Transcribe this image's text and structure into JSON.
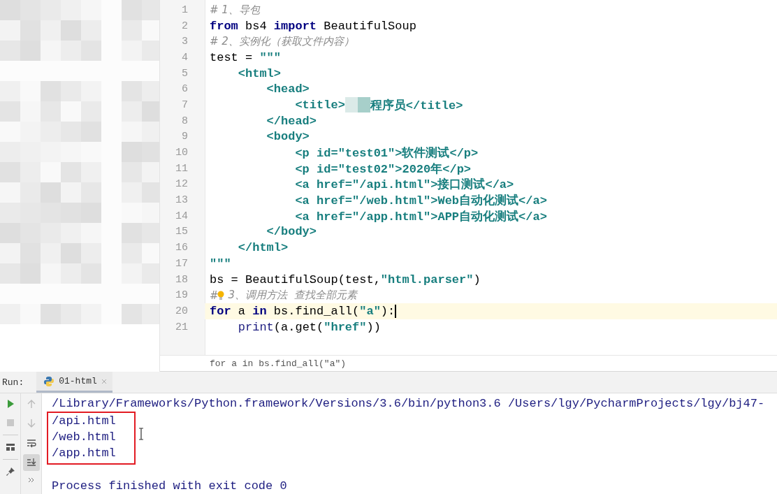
{
  "editor": {
    "lines": [
      {
        "number": "1",
        "current": false,
        "tokens": [
          {
            "kind": "comment",
            "text": "# 1、导包"
          }
        ]
      },
      {
        "number": "2",
        "current": false,
        "tokens": [
          {
            "kind": "keyword",
            "text": "from"
          },
          {
            "kind": "plain",
            "text": " bs4 "
          },
          {
            "kind": "keyword",
            "text": "import"
          },
          {
            "kind": "plain",
            "text": " BeautifulSoup"
          }
        ]
      },
      {
        "number": "3",
        "current": false,
        "tokens": [
          {
            "kind": "comment",
            "text": "# 2、实例化（获取文件内容）"
          }
        ]
      },
      {
        "number": "4",
        "current": false,
        "tokens": [
          {
            "kind": "plain",
            "text": "test = "
          },
          {
            "kind": "string",
            "text": "\"\"\""
          }
        ]
      },
      {
        "number": "5",
        "current": false,
        "tokens": [
          {
            "kind": "tag",
            "text": "    <html>"
          }
        ]
      },
      {
        "number": "6",
        "current": false,
        "tokens": [
          {
            "kind": "tag",
            "text": "        <head>"
          }
        ]
      },
      {
        "number": "7",
        "current": false,
        "tokens": [
          {
            "kind": "tag",
            "text": "            <title>"
          },
          {
            "kind": "redacted"
          },
          {
            "kind": "tag",
            "text": "程序员</title>"
          }
        ]
      },
      {
        "number": "8",
        "current": false,
        "tokens": [
          {
            "kind": "tag",
            "text": "        </head>"
          }
        ]
      },
      {
        "number": "9",
        "current": false,
        "tokens": [
          {
            "kind": "tag",
            "text": "        <body>"
          }
        ]
      },
      {
        "number": "10",
        "current": false,
        "tokens": [
          {
            "kind": "tag",
            "text": "            <p id=\"test01\">软件测试</p>"
          }
        ]
      },
      {
        "number": "11",
        "current": false,
        "tokens": [
          {
            "kind": "tag",
            "text": "            <p id=\"test02\">2020年</p>"
          }
        ]
      },
      {
        "number": "12",
        "current": false,
        "tokens": [
          {
            "kind": "tag",
            "text": "            <a href=\"/api.html\">接口测试</a>"
          }
        ]
      },
      {
        "number": "13",
        "current": false,
        "tokens": [
          {
            "kind": "tag",
            "text": "            <a href=\"/web.html\">Web自动化测试</a>"
          }
        ]
      },
      {
        "number": "14",
        "current": false,
        "tokens": [
          {
            "kind": "tag",
            "text": "            <a href=\"/app.html\">APP自动化测试</a>"
          }
        ]
      },
      {
        "number": "15",
        "current": false,
        "tokens": [
          {
            "kind": "tag",
            "text": "        </body>"
          }
        ]
      },
      {
        "number": "16",
        "current": false,
        "tokens": [
          {
            "kind": "tag",
            "text": "    </html>"
          }
        ]
      },
      {
        "number": "17",
        "current": false,
        "tokens": [
          {
            "kind": "string",
            "text": "\"\"\""
          }
        ]
      },
      {
        "number": "18",
        "current": false,
        "tokens": [
          {
            "kind": "plain",
            "text": "bs = BeautifulSoup(test,"
          },
          {
            "kind": "string",
            "text": "\"html.parser\""
          },
          {
            "kind": "plain",
            "text": ")"
          }
        ]
      },
      {
        "number": "19",
        "current": false,
        "tokens": [
          {
            "kind": "comment",
            "text": "#"
          },
          {
            "kind": "bulb"
          },
          {
            "kind": "comment",
            "text": "3、调用方法  查找全部元素"
          }
        ]
      },
      {
        "number": "20",
        "current": true,
        "tokens": [
          {
            "kind": "keyword",
            "text": "for"
          },
          {
            "kind": "plain",
            "text": " a "
          },
          {
            "kind": "keyword",
            "text": "in"
          },
          {
            "kind": "plain",
            "text": " bs.find_all("
          },
          {
            "kind": "string",
            "text": "\"a\""
          },
          {
            "kind": "plain",
            "text": "):"
          },
          {
            "kind": "caret"
          }
        ]
      },
      {
        "number": "21",
        "current": false,
        "tokens": [
          {
            "kind": "builtin",
            "text": "    print"
          },
          {
            "kind": "plain",
            "text": "(a.get("
          },
          {
            "kind": "string",
            "text": "\"href\""
          },
          {
            "kind": "plain",
            "text": "))"
          }
        ]
      }
    ],
    "breadcrumb": "for a in bs.find_all(\"a\")"
  },
  "run_panel": {
    "label": "Run:",
    "tab": {
      "title": "01-html",
      "selected": true
    },
    "output": [
      {
        "kind": "command",
        "boxed": false,
        "text": "/Library/Frameworks/Python.framework/Versions/3.6/bin/python3.6 /Users/lgy/PycharmProjects/lgy/bj47-"
      },
      {
        "kind": "result",
        "boxed": true,
        "text": "/api.html"
      },
      {
        "kind": "result",
        "boxed": true,
        "text": "/web.html"
      },
      {
        "kind": "result",
        "boxed": true,
        "text": "/app.html"
      },
      {
        "kind": "exit",
        "boxed": false,
        "text": "Process finished with exit code 0"
      }
    ]
  }
}
